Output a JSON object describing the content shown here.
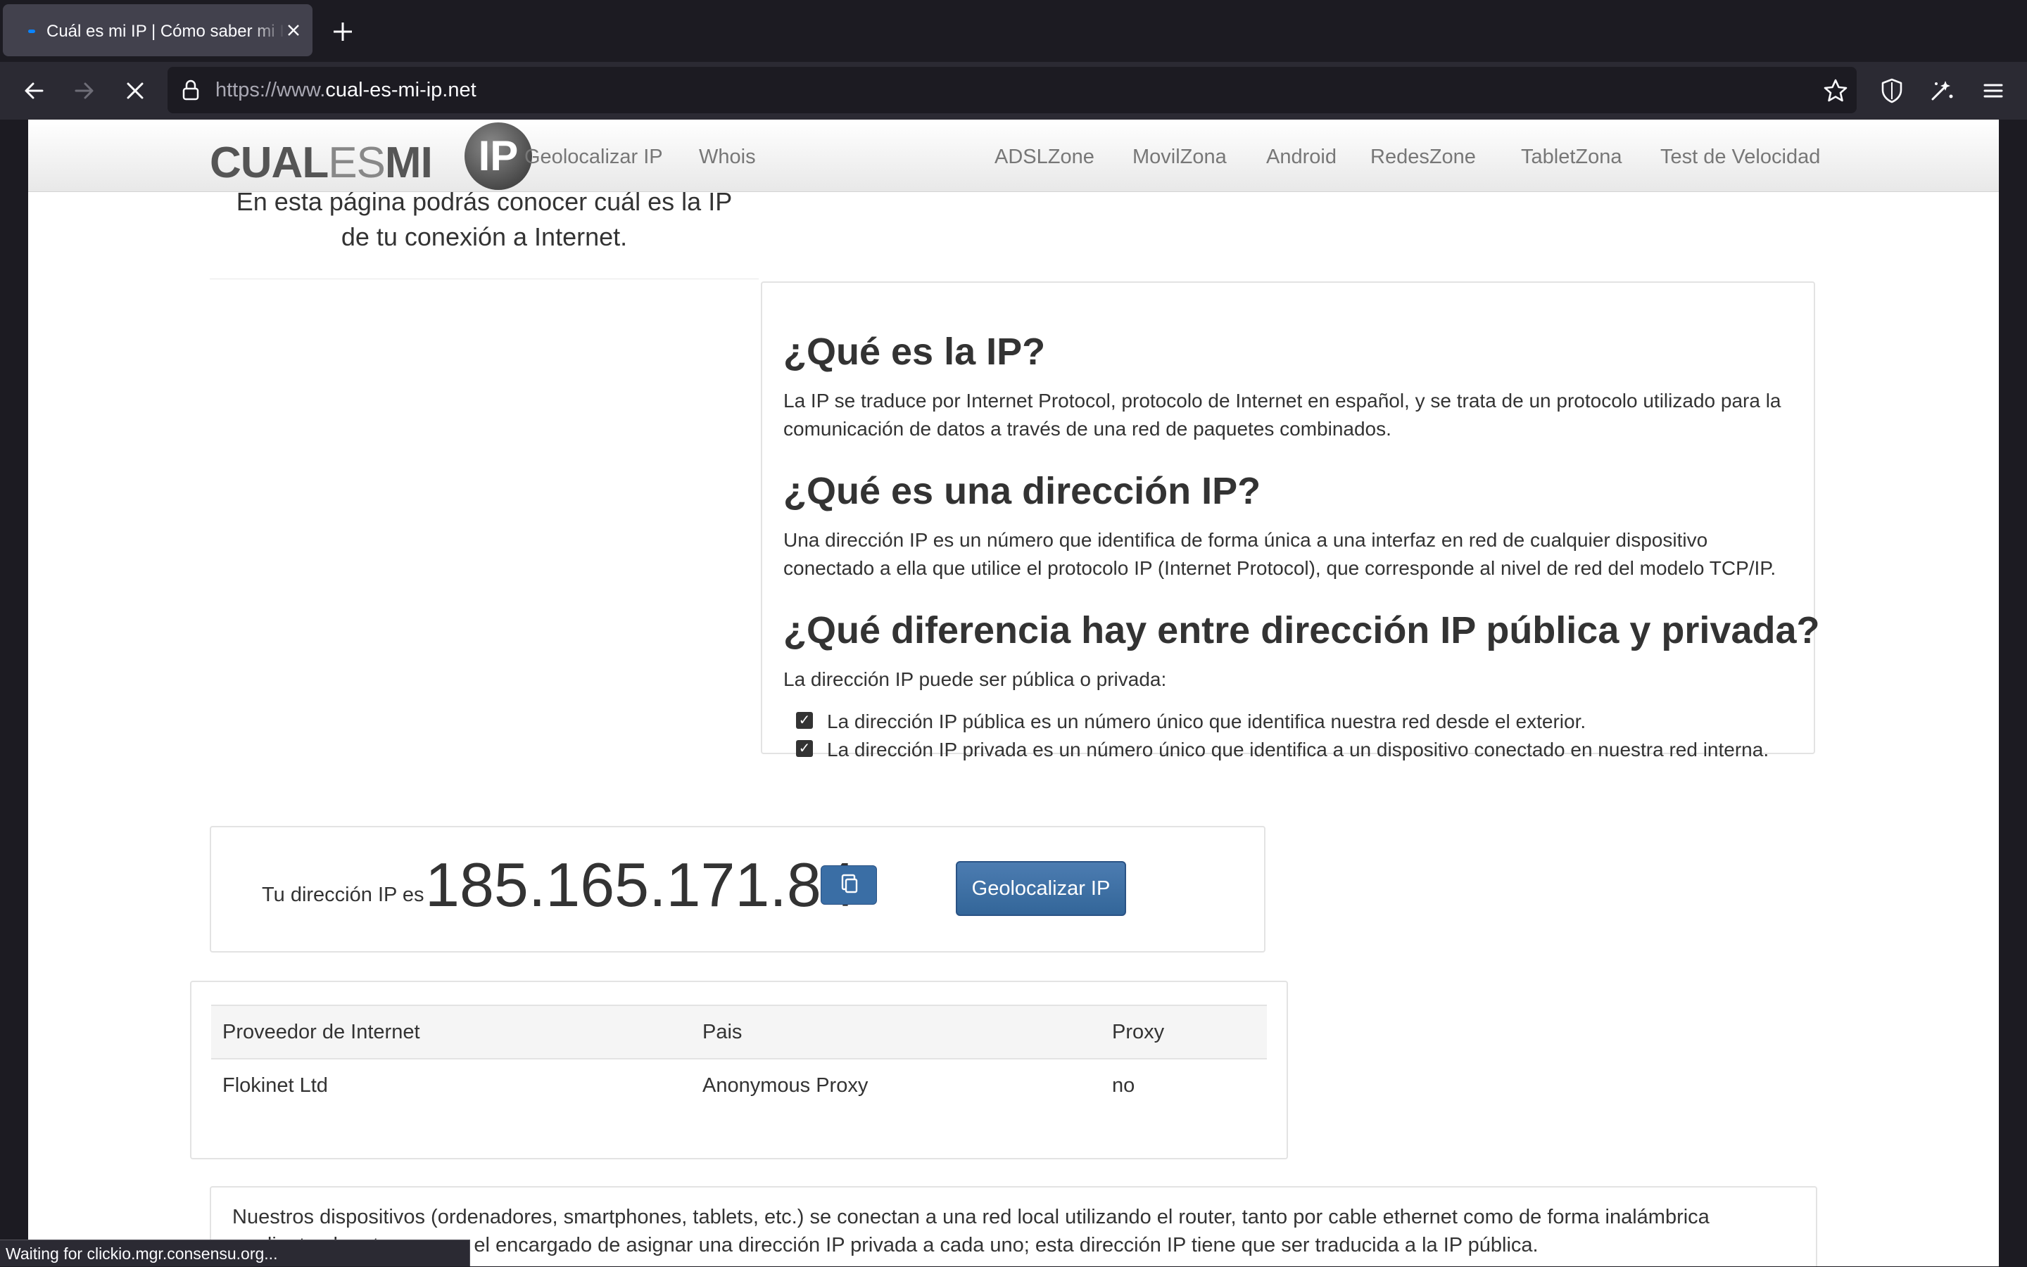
{
  "browser": {
    "tab": {
      "title": "Cuál es mi IP | Cómo saber mi IP"
    },
    "url": {
      "prefix": "https://www.",
      "domain": "cual-es-mi-ip.net"
    },
    "icons": [
      "back-arrow-icon",
      "forward-arrow-icon",
      "stop-loading-icon",
      "lock-icon",
      "bookmark-star-icon",
      "shield-icon",
      "extension-icon",
      "hamburger-menu-icon"
    ],
    "status": "Waiting for clickio.mgr.consensu.org..."
  },
  "site": {
    "logo": {
      "part1": "CUAL",
      "part2": "ES",
      "part3": "MI",
      "badge": "IP"
    },
    "nav_left": [
      "Geolocalizar IP",
      "Whois"
    ],
    "nav_right": [
      "ADSLZone",
      "MovilZona",
      "Android",
      "RedesZone",
      "TabletZona",
      "Test de Velocidad"
    ]
  },
  "hero": {
    "line1": "En esta página podrás conocer cuál es la IP",
    "line2": "de tu conexión a Internet."
  },
  "info": {
    "q1": "¿Qué es la IP?",
    "a1": "La IP se traduce por Internet Protocol, protocolo de Internet en español, y se trata de un protocolo utilizado para la comunicación de datos a través de una red de paquetes combinados.",
    "q2": "¿Qué es una dirección IP?",
    "a2": "Una dirección IP es un número que identifica de forma única a una interfaz en red de cualquier dispositivo conectado a ella que utilice el protocolo IP (Internet Protocol), que corresponde al nivel de red del modelo TCP/IP.",
    "q3": "¿Qué diferencia hay entre dirección IP pública y privada?",
    "a3": "La dirección IP puede ser pública o privada:",
    "bullets": [
      "La dirección IP pública es un número único que identifica nuestra red desde el exterior.",
      "La dirección IP privada es un número único que identifica a un dispositivo conectado en nuestra red interna."
    ]
  },
  "ip_box": {
    "label": "Tu dirección IP es",
    "value": "185.165.171.84",
    "geo_button": "Geolocalizar IP"
  },
  "details_table": {
    "headers": [
      "Proveedor de Internet",
      "Pais",
      "Proxy"
    ],
    "rows": [
      [
        "Flokinet Ltd",
        "Anonymous Proxy",
        "no"
      ]
    ]
  },
  "bottom_text": "Nuestros dispositivos (ordenadores, smartphones, tablets, etc.) se conectan a una red local utilizando el router, tanto por cable ethernet como de forma inalámbrica mediante el router, que es el encargado de asignar una dirección IP privada a cada uno; esta dirección IP tiene que ser traducida a la IP pública.",
  "colors": {
    "accent_button": "#336699",
    "chrome_dark": "#1c1b22",
    "chrome_bar": "#2b2a33"
  }
}
